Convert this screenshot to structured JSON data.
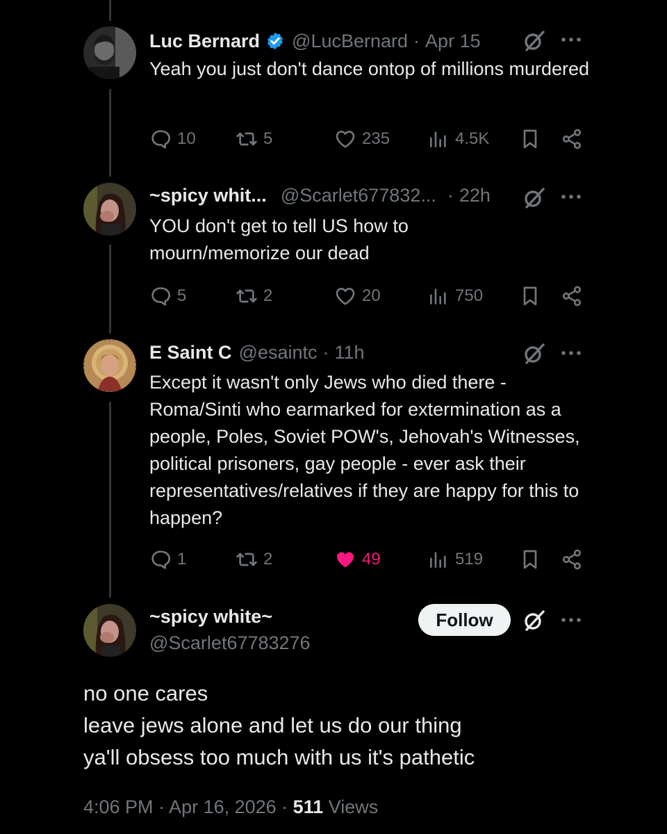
{
  "tweets": [
    {
      "name": "Luc Bernard",
      "handle": "@LucBernard",
      "time": "Apr 15",
      "verified": true,
      "text": "Yeah you just don't dance ontop of millions murdered",
      "replies": "10",
      "reposts": "5",
      "likes": "235",
      "views": "4.5K"
    },
    {
      "name": "~spicy whit...",
      "handle": "@Scarlet677832...",
      "time": "22h",
      "text": "YOU don't get to tell US how to mourn/memorize our dead",
      "replies": "5",
      "reposts": "2",
      "likes": "20",
      "views": "750"
    },
    {
      "name": "E Saint C",
      "handle": "@esaintc",
      "time": "11h",
      "text": "Except it wasn't only Jews who died there - Roma/Sinti who earmarked for extermination as a people, Poles, Soviet POW's, Jehovah's Witnesses, political prisoners, gay people - ever ask their representatives/relatives if they are happy for this to happen?",
      "replies": "1",
      "reposts": "2",
      "likes": "49",
      "liked": true,
      "views": "519"
    }
  ],
  "main": {
    "name": "~spicy white~",
    "handle": "@Scarlet67783276",
    "follow_label": "Follow",
    "lines": [
      "no one cares",
      "leave jews alone and let us do our thing",
      "ya'll obsess too much with us it's pathetic"
    ],
    "timestamp": "4:06 PM · Apr 16, 2026 · ",
    "views_count": "511",
    "views_label": " Views"
  },
  "colors": {
    "background": "#000000",
    "text": "#e7e9ea",
    "secondary": "#71767b",
    "like": "#f91880",
    "verified": "#1d9bf0"
  }
}
